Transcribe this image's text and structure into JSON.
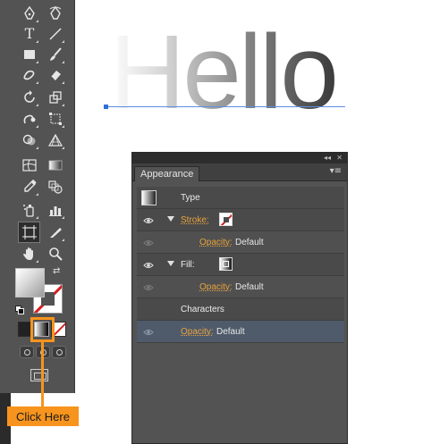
{
  "canvas": {
    "text": "Hello"
  },
  "toolbar": {
    "tools": [
      {
        "name": "pen-icon"
      },
      {
        "name": "curvature-pen-icon"
      },
      {
        "name": "type-icon",
        "glyph": "T"
      },
      {
        "name": "line-segment-icon"
      },
      {
        "name": "rectangle-icon"
      },
      {
        "name": "paintbrush-icon"
      },
      {
        "name": "shaper-icon"
      },
      {
        "name": "eraser-icon"
      },
      {
        "name": "rotate-icon"
      },
      {
        "name": "scale-icon"
      },
      {
        "name": "warp-icon"
      },
      {
        "name": "free-transform-icon"
      },
      {
        "name": "shape-builder-icon"
      },
      {
        "name": "perspective-grid-icon"
      },
      {
        "name": "mesh-icon"
      },
      {
        "name": "gradient-icon"
      },
      {
        "name": "eyedropper-icon"
      },
      {
        "name": "blend-icon"
      },
      {
        "name": "symbol-sprayer-icon"
      },
      {
        "name": "column-graph-icon"
      },
      {
        "name": "artboard-icon"
      },
      {
        "name": "slice-icon"
      },
      {
        "name": "hand-icon"
      },
      {
        "name": "zoom-icon"
      }
    ],
    "stroke_color": "#d81e1e",
    "highlight_color": "#f7941d"
  },
  "callout": {
    "label": "Click Here"
  },
  "appearance_panel": {
    "tab_label": "Appearance",
    "rows": {
      "type_label": "Type",
      "stroke_label": "Stroke:",
      "stroke_opacity_label": "Opacity:",
      "stroke_opacity_value": "Default",
      "fill_label": "Fill:",
      "fill_opacity_label": "Opacity:",
      "fill_opacity_value": "Default",
      "characters_label": "Characters",
      "char_opacity_label": "Opacity:",
      "char_opacity_value": "Default"
    },
    "link_color": "#e8a33d",
    "selected_row_color": "#4f5b6b"
  }
}
